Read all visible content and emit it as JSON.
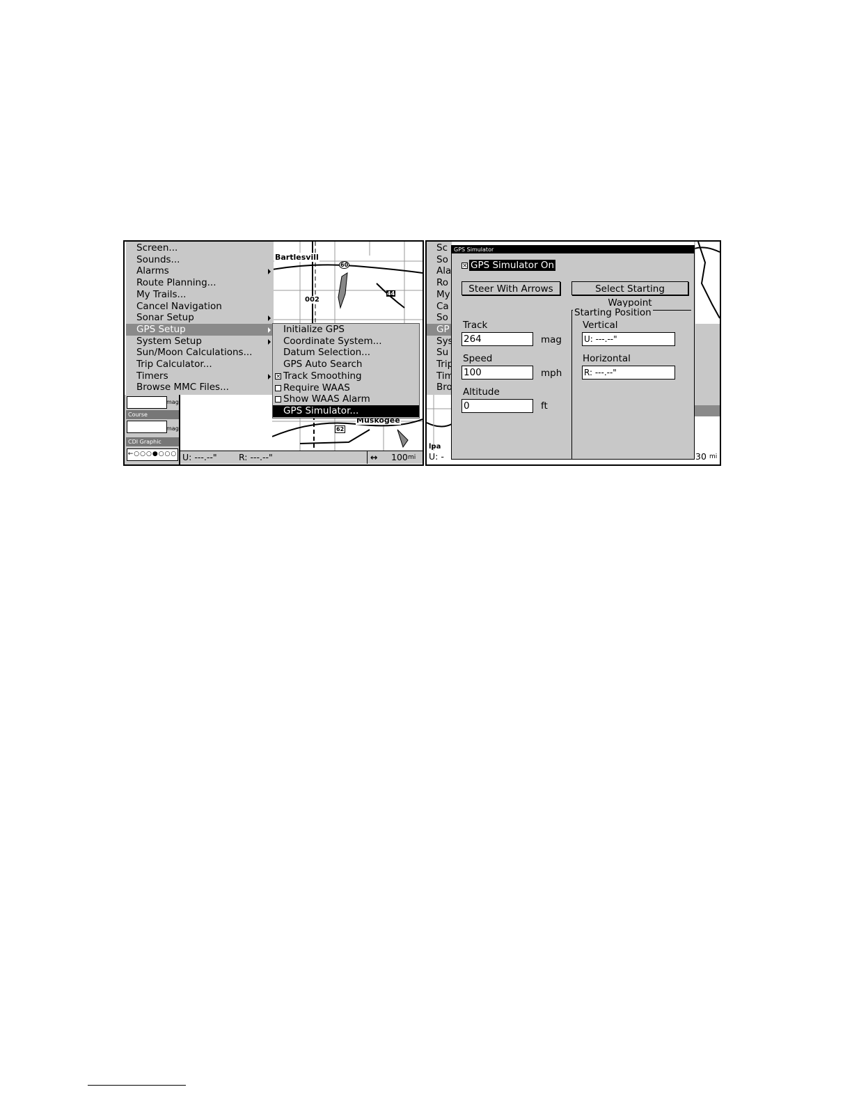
{
  "left_screen": {
    "main_menu": [
      {
        "label": "Screen...",
        "submenu": false
      },
      {
        "label": "Sounds...",
        "submenu": false
      },
      {
        "label": "Alarms",
        "submenu": true
      },
      {
        "label": "Route Planning...",
        "submenu": false
      },
      {
        "label": "My Trails...",
        "submenu": false
      },
      {
        "label": "Cancel Navigation",
        "submenu": false
      },
      {
        "label": "Sonar Setup",
        "submenu": true
      },
      {
        "label": "GPS Setup",
        "submenu": true,
        "selected": true
      },
      {
        "label": "System Setup",
        "submenu": true
      },
      {
        "label": "Sun/Moon Calculations...",
        "submenu": false
      },
      {
        "label": "Trip Calculator...",
        "submenu": false
      },
      {
        "label": "Timers",
        "submenu": true
      },
      {
        "label": "Browse MMC Files...",
        "submenu": false
      }
    ],
    "gps_submenu": [
      {
        "label": "Initialize GPS"
      },
      {
        "label": "Coordinate System..."
      },
      {
        "label": "Datum Selection..."
      },
      {
        "label": "GPS Auto Search"
      },
      {
        "label": "Track Smoothing",
        "checkbox": true,
        "checked": true
      },
      {
        "label": "Require WAAS",
        "checkbox": true,
        "checked": false
      },
      {
        "label": "Show WAAS Alarm",
        "checkbox": true,
        "checked": false
      },
      {
        "label": "GPS Simulator...",
        "selected": true
      }
    ],
    "map_labels": {
      "city_top": "Bartlesvill",
      "city_bottom": "Muskogee",
      "route_60": "60",
      "route_44": "44",
      "route_62": "62",
      "label_002": "002"
    },
    "panel": {
      "unit_top": "mag",
      "course_title": "Course",
      "course_unit": "mag",
      "cdi_title": "CDI Graphic",
      "cdi_scale": "←○○○●○○○"
    },
    "status": {
      "u": "U:  ---.--\"",
      "r": "R:  ---.--\"",
      "range_icon": "↔",
      "range_value": "100",
      "range_unit": "mi"
    }
  },
  "right_screen": {
    "behind_menu": [
      {
        "label": "Sc"
      },
      {
        "label": "So"
      },
      {
        "label": "Ala"
      },
      {
        "label": "Ro"
      },
      {
        "label": "My"
      },
      {
        "label": "Ca"
      },
      {
        "label": "So"
      },
      {
        "label": "GP",
        "selected": true
      },
      {
        "label": "Sys"
      },
      {
        "label": "Su"
      },
      {
        "label": "Trip"
      },
      {
        "label": "Tim"
      },
      {
        "label": "Bro"
      }
    ],
    "dialog": {
      "title": "GPS Simulator",
      "simulator_on_label": "GPS Simulator On",
      "simulator_on_checked": true,
      "steer_button": "Steer With Arrows",
      "select_waypoint_button": "Select Starting Waypoint",
      "track_label": "Track",
      "track_value": "264",
      "track_unit": "mag",
      "speed_label": "Speed",
      "speed_value": "100",
      "speed_unit": "mph",
      "altitude_label": "Altitude",
      "altitude_value": "0",
      "altitude_unit": "ft",
      "starting_position_label": "Starting Position",
      "vertical_label": "Vertical",
      "vertical_value": "U:  ---.--\"",
      "horizontal_label": "Horizontal",
      "horizontal_value": "R:  ---.--\""
    },
    "status": {
      "u": "U:  -",
      "map_label": "lpa",
      "range_value": "30",
      "range_unit": "mi"
    }
  }
}
